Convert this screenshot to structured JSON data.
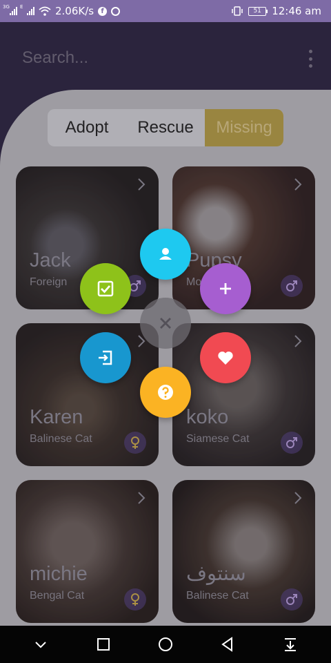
{
  "status_bar": {
    "net_speed": "2.06K/s",
    "signal_1_tag": "3G",
    "signal_2_tag": "E",
    "battery_level": "51",
    "time": "12:46 am",
    "icons": [
      "signal-icon",
      "signal-icon",
      "wifi-icon",
      "facebook-icon",
      "whatsapp-icon",
      "vibrate-icon",
      "battery-icon"
    ]
  },
  "header": {
    "search_placeholder": "Search...",
    "menu_icon": "more-vert-icon"
  },
  "tabs": [
    {
      "label": "Adopt"
    },
    {
      "label": "Rescue"
    },
    {
      "label": "Missing",
      "active": true
    }
  ],
  "cards": [
    {
      "name": "Jack",
      "breed": "Foreign",
      "gender": "male"
    },
    {
      "name": "Pupsy",
      "breed": "Mo",
      "gender": "male"
    },
    {
      "name": "Karen",
      "breed": "Balinese Cat",
      "gender": "female"
    },
    {
      "name": "koko",
      "breed": "Siamese Cat",
      "gender": "male"
    },
    {
      "name": "michie",
      "breed": "Bengal Cat",
      "gender": "female"
    },
    {
      "name": "سنتوف",
      "breed": "Balinese Cat",
      "gender": "male"
    }
  ],
  "fab_menu": {
    "items": [
      {
        "icon": "person-icon",
        "color": "#1ec9f0"
      },
      {
        "icon": "checkbox-icon",
        "color": "#8ec21a"
      },
      {
        "icon": "add-icon",
        "color": "#a65ed0"
      },
      {
        "icon": "close-icon",
        "color": "#6f6c72"
      },
      {
        "icon": "exit-to-app-icon",
        "color": "#1897cf"
      },
      {
        "icon": "heart-icon",
        "color": "#f14a52"
      },
      {
        "icon": "help-icon",
        "color": "#fbb323"
      }
    ]
  },
  "nav_bar": {
    "icons": [
      "chevron-down-icon",
      "recents-square-icon",
      "home-circle-icon",
      "back-triangle-icon",
      "notification-pull-icon"
    ]
  },
  "colors": {
    "status_bar": "#7e6ba6",
    "header_bg": "#2d2541",
    "active_tab": "#b39b45",
    "panel_bg": "#b9b8bc"
  }
}
